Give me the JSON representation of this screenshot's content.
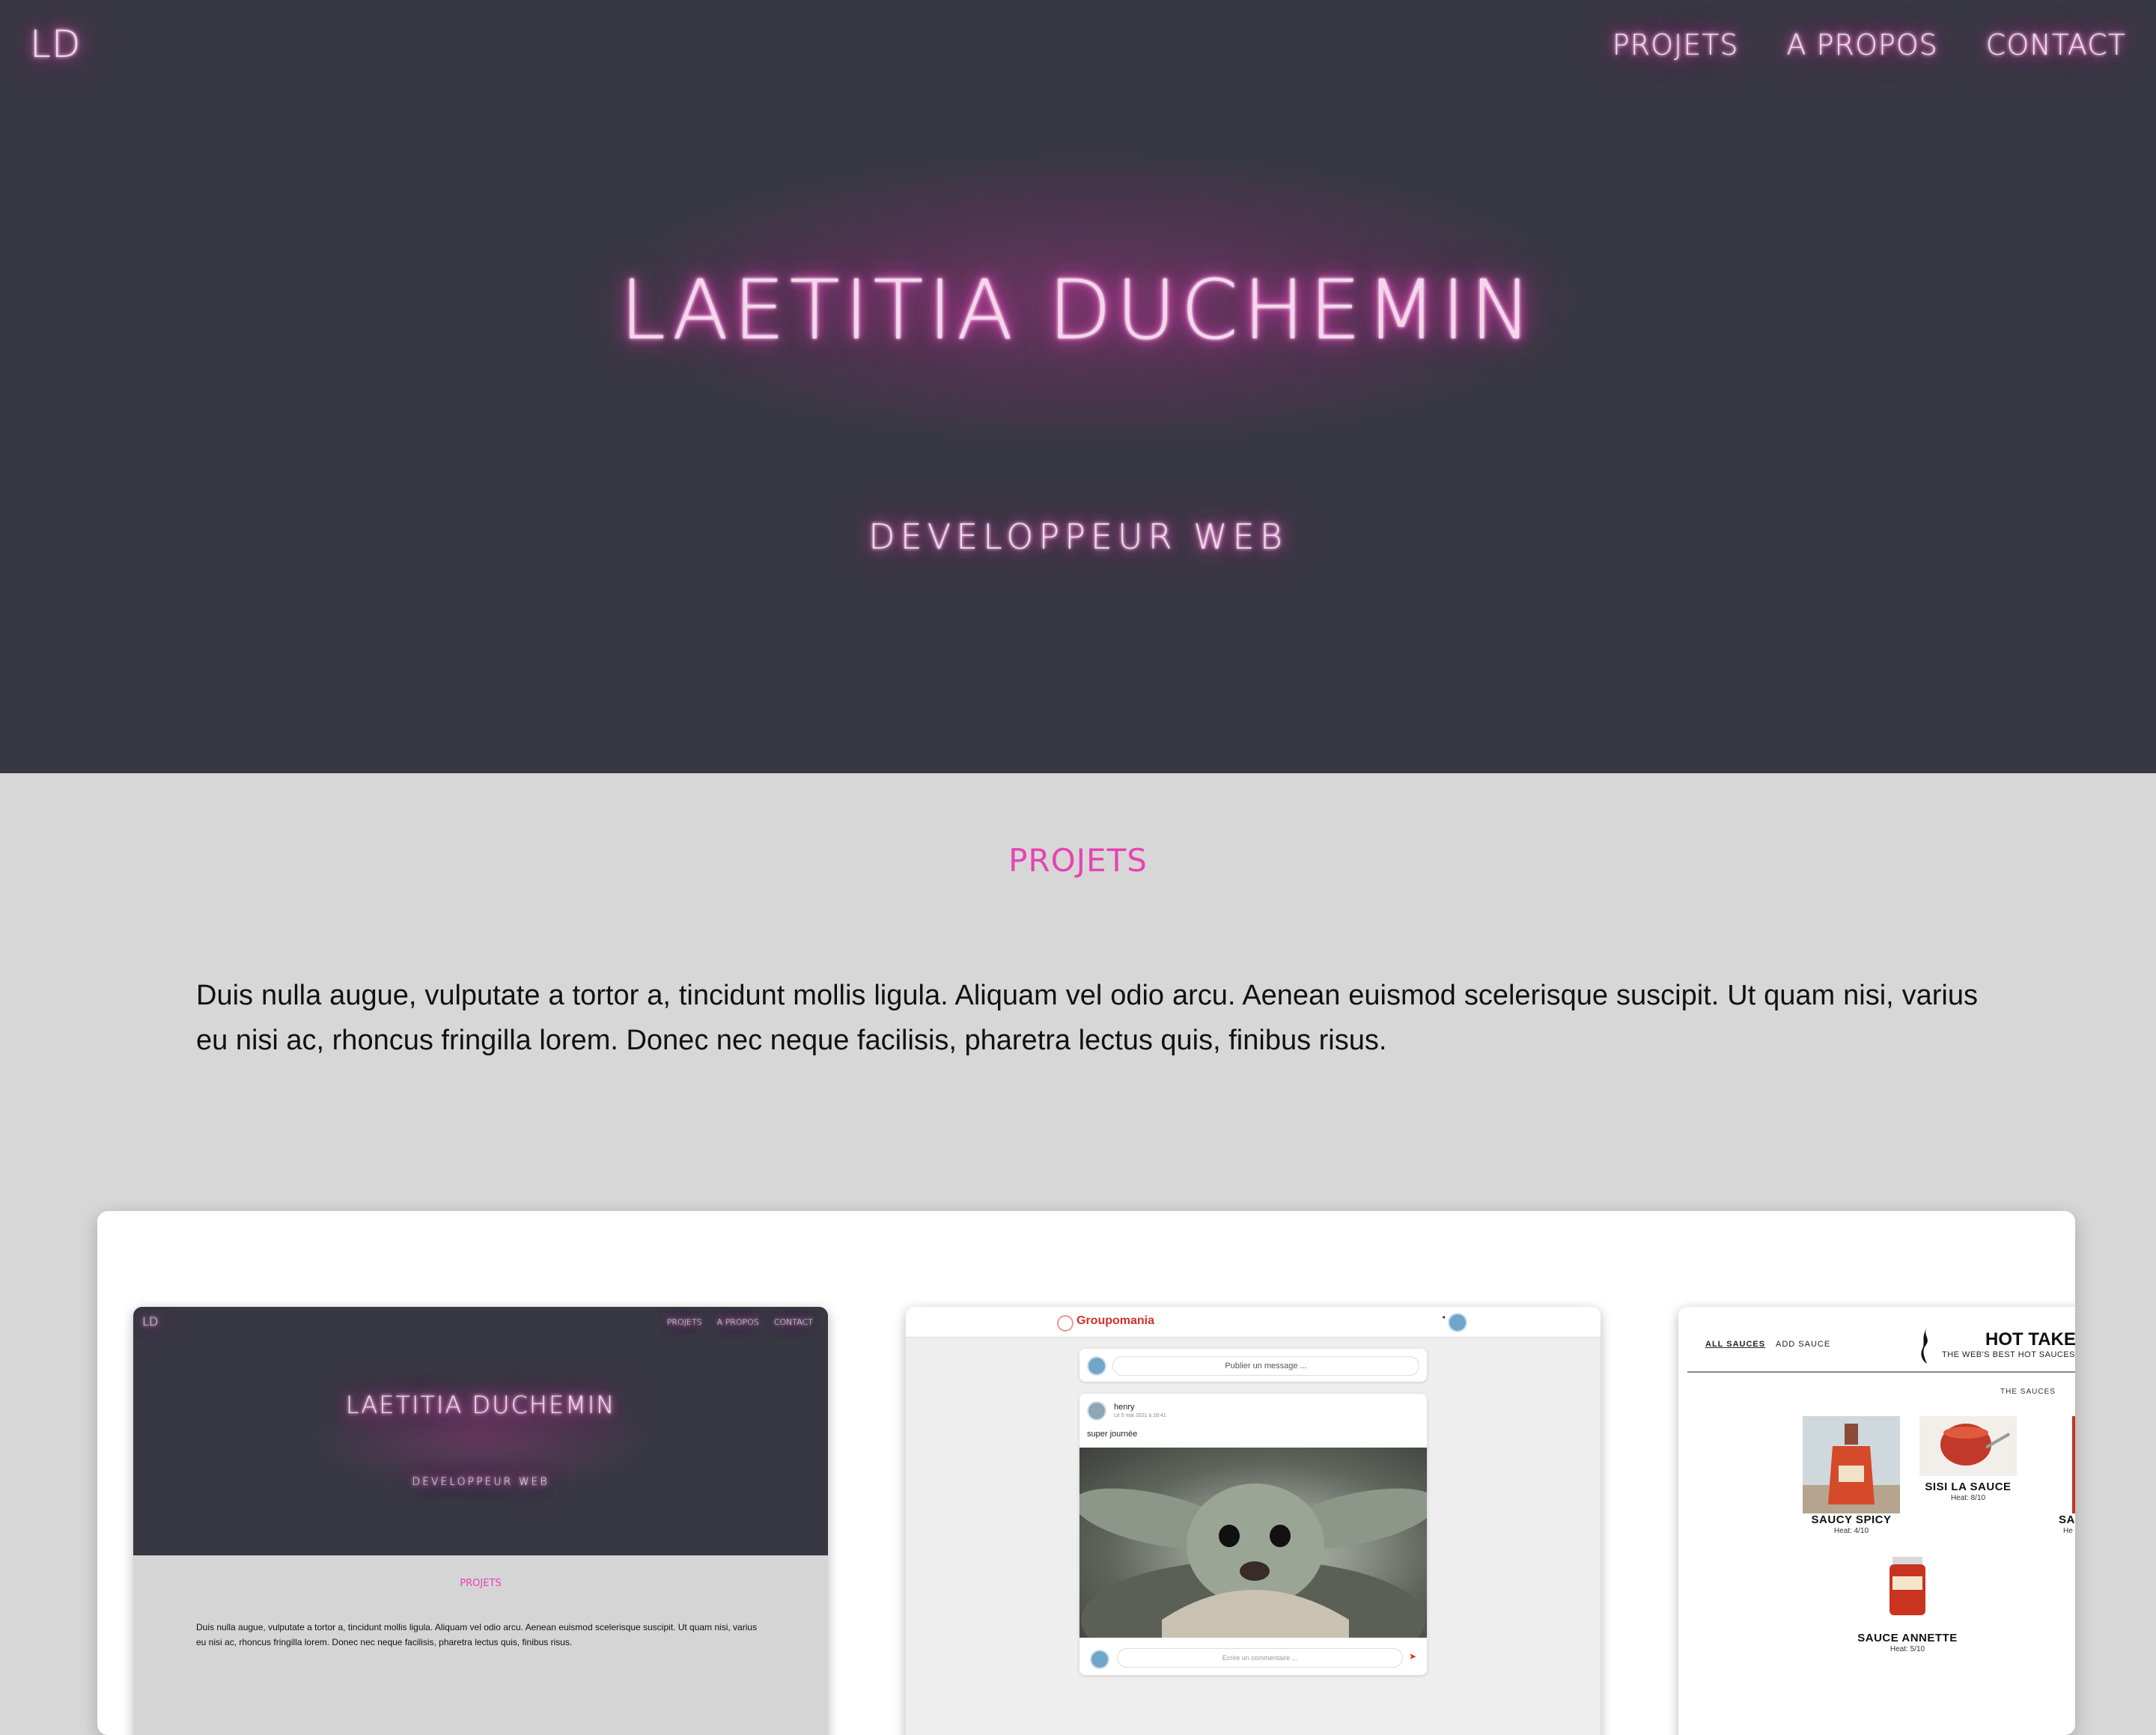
{
  "header": {
    "logo": "LD",
    "nav": [
      "PROJETS",
      "A PROPOS",
      "CONTACT"
    ]
  },
  "hero": {
    "title": "LAETITIA DUCHEMIN",
    "subtitle": "DEVELOPPEUR WEB"
  },
  "projects": {
    "title": "PROJETS",
    "text": "Duis nulla augue, vulputate a tortor a, tincidunt mollis ligula. Aliquam vel odio arcu. Aenean euismod scelerisque suscipit. Ut quam nisi, varius eu nisi ac, rhoncus fringilla lorem. Donec nec neque facilisis, pharetra lectus quis, finibus risus."
  },
  "thumb_portfolio": {
    "logo": "LD",
    "nav": [
      "PROJETS",
      "A PROPOS",
      "CONTACT"
    ],
    "title": "LAETITIA DUCHEMIN",
    "subtitle": "DEVELOPPEUR WEB",
    "section": "PROJETS",
    "text": "Duis nulla augue, vulputate a tortor a, tincidunt mollis ligula. Aliquam vel odio arcu. Aenean euismod scelerisque suscipit. Ut quam nisi, varius eu nisi ac, rhoncus fringilla lorem. Donec nec neque facilisis, pharetra lectus quis, finibus risus."
  },
  "thumb_groupomania": {
    "brand": "Groupomania",
    "publish_placeholder": "Publier un message ...",
    "author": "henry",
    "date": "Le 5 mai 2021 à 18:41",
    "message": "super journée",
    "comment_placeholder": "Ecrire un commentaire ..."
  },
  "thumb_hottakes": {
    "links": [
      "ALL SAUCES",
      "ADD SAUCE"
    ],
    "brand": "HOT TAKES",
    "tagline": "THE WEB'S BEST HOT SAUCES",
    "section": "THE SAUCES",
    "sauces": [
      {
        "name": "SAUCY SPICY",
        "heat": "Heat: 4/10"
      },
      {
        "name": "SISI LA SAUCE",
        "heat": "Heat: 8/10"
      },
      {
        "name": "SAUCE ANNETTE",
        "heat": "Heat: 5/10"
      }
    ],
    "partial_name": "SAU",
    "partial_heat": "He"
  },
  "colors": {
    "hero_bg": "#383842",
    "page_bg": "#d7d7d7",
    "neon_pink": "#ff5cd0",
    "section_title_pink": "#e544b4",
    "groupomania_red": "#d4312a"
  }
}
